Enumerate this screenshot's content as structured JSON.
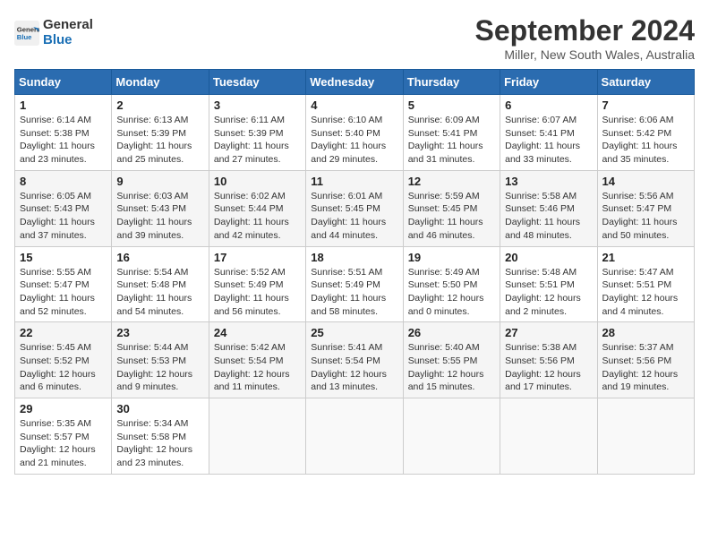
{
  "header": {
    "logo_line1": "General",
    "logo_line2": "Blue",
    "month_year": "September 2024",
    "location": "Miller, New South Wales, Australia"
  },
  "days_of_week": [
    "Sunday",
    "Monday",
    "Tuesday",
    "Wednesday",
    "Thursday",
    "Friday",
    "Saturday"
  ],
  "weeks": [
    [
      {
        "day": "1",
        "info": "Sunrise: 6:14 AM\nSunset: 5:38 PM\nDaylight: 11 hours\nand 23 minutes."
      },
      {
        "day": "2",
        "info": "Sunrise: 6:13 AM\nSunset: 5:39 PM\nDaylight: 11 hours\nand 25 minutes."
      },
      {
        "day": "3",
        "info": "Sunrise: 6:11 AM\nSunset: 5:39 PM\nDaylight: 11 hours\nand 27 minutes."
      },
      {
        "day": "4",
        "info": "Sunrise: 6:10 AM\nSunset: 5:40 PM\nDaylight: 11 hours\nand 29 minutes."
      },
      {
        "day": "5",
        "info": "Sunrise: 6:09 AM\nSunset: 5:41 PM\nDaylight: 11 hours\nand 31 minutes."
      },
      {
        "day": "6",
        "info": "Sunrise: 6:07 AM\nSunset: 5:41 PM\nDaylight: 11 hours\nand 33 minutes."
      },
      {
        "day": "7",
        "info": "Sunrise: 6:06 AM\nSunset: 5:42 PM\nDaylight: 11 hours\nand 35 minutes."
      }
    ],
    [
      {
        "day": "8",
        "info": "Sunrise: 6:05 AM\nSunset: 5:43 PM\nDaylight: 11 hours\nand 37 minutes."
      },
      {
        "day": "9",
        "info": "Sunrise: 6:03 AM\nSunset: 5:43 PM\nDaylight: 11 hours\nand 39 minutes."
      },
      {
        "day": "10",
        "info": "Sunrise: 6:02 AM\nSunset: 5:44 PM\nDaylight: 11 hours\nand 42 minutes."
      },
      {
        "day": "11",
        "info": "Sunrise: 6:01 AM\nSunset: 5:45 PM\nDaylight: 11 hours\nand 44 minutes."
      },
      {
        "day": "12",
        "info": "Sunrise: 5:59 AM\nSunset: 5:45 PM\nDaylight: 11 hours\nand 46 minutes."
      },
      {
        "day": "13",
        "info": "Sunrise: 5:58 AM\nSunset: 5:46 PM\nDaylight: 11 hours\nand 48 minutes."
      },
      {
        "day": "14",
        "info": "Sunrise: 5:56 AM\nSunset: 5:47 PM\nDaylight: 11 hours\nand 50 minutes."
      }
    ],
    [
      {
        "day": "15",
        "info": "Sunrise: 5:55 AM\nSunset: 5:47 PM\nDaylight: 11 hours\nand 52 minutes."
      },
      {
        "day": "16",
        "info": "Sunrise: 5:54 AM\nSunset: 5:48 PM\nDaylight: 11 hours\nand 54 minutes."
      },
      {
        "day": "17",
        "info": "Sunrise: 5:52 AM\nSunset: 5:49 PM\nDaylight: 11 hours\nand 56 minutes."
      },
      {
        "day": "18",
        "info": "Sunrise: 5:51 AM\nSunset: 5:49 PM\nDaylight: 11 hours\nand 58 minutes."
      },
      {
        "day": "19",
        "info": "Sunrise: 5:49 AM\nSunset: 5:50 PM\nDaylight: 12 hours\nand 0 minutes."
      },
      {
        "day": "20",
        "info": "Sunrise: 5:48 AM\nSunset: 5:51 PM\nDaylight: 12 hours\nand 2 minutes."
      },
      {
        "day": "21",
        "info": "Sunrise: 5:47 AM\nSunset: 5:51 PM\nDaylight: 12 hours\nand 4 minutes."
      }
    ],
    [
      {
        "day": "22",
        "info": "Sunrise: 5:45 AM\nSunset: 5:52 PM\nDaylight: 12 hours\nand 6 minutes."
      },
      {
        "day": "23",
        "info": "Sunrise: 5:44 AM\nSunset: 5:53 PM\nDaylight: 12 hours\nand 9 minutes."
      },
      {
        "day": "24",
        "info": "Sunrise: 5:42 AM\nSunset: 5:54 PM\nDaylight: 12 hours\nand 11 minutes."
      },
      {
        "day": "25",
        "info": "Sunrise: 5:41 AM\nSunset: 5:54 PM\nDaylight: 12 hours\nand 13 minutes."
      },
      {
        "day": "26",
        "info": "Sunrise: 5:40 AM\nSunset: 5:55 PM\nDaylight: 12 hours\nand 15 minutes."
      },
      {
        "day": "27",
        "info": "Sunrise: 5:38 AM\nSunset: 5:56 PM\nDaylight: 12 hours\nand 17 minutes."
      },
      {
        "day": "28",
        "info": "Sunrise: 5:37 AM\nSunset: 5:56 PM\nDaylight: 12 hours\nand 19 minutes."
      }
    ],
    [
      {
        "day": "29",
        "info": "Sunrise: 5:35 AM\nSunset: 5:57 PM\nDaylight: 12 hours\nand 21 minutes."
      },
      {
        "day": "30",
        "info": "Sunrise: 5:34 AM\nSunset: 5:58 PM\nDaylight: 12 hours\nand 23 minutes."
      },
      {
        "day": "",
        "info": ""
      },
      {
        "day": "",
        "info": ""
      },
      {
        "day": "",
        "info": ""
      },
      {
        "day": "",
        "info": ""
      },
      {
        "day": "",
        "info": ""
      }
    ]
  ]
}
